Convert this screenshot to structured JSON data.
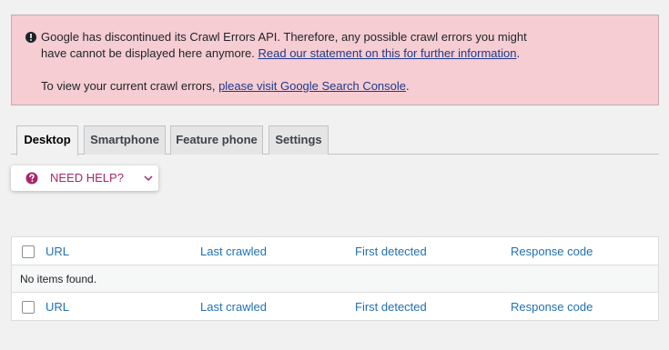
{
  "notice": {
    "line1": "Google has discontinued its Crawl Errors API. Therefore, any possible crawl errors you might",
    "line2_prefix": "have cannot be displayed here anymore. ",
    "line2_link": "Read our statement on this for further information",
    "line2_suffix": ".",
    "line3_prefix": "To view your current crawl errors, ",
    "line3_link": "please visit Google Search Console",
    "line3_suffix": ".",
    "icon": "alert-circle-icon",
    "colors": {
      "background": "#f6cdd3",
      "link": "#1e3a8a"
    }
  },
  "tabs": [
    {
      "label": "Desktop",
      "active": true
    },
    {
      "label": "Smartphone",
      "active": false
    },
    {
      "label": "Feature phone",
      "active": false
    },
    {
      "label": "Settings",
      "active": false
    }
  ],
  "help": {
    "label": "NEED HELP?",
    "icon": "question-circle-icon",
    "chevron": "chevron-down-icon",
    "color": "#a4286a"
  },
  "table": {
    "columns": [
      "URL",
      "Last crawled",
      "First detected",
      "Response code"
    ],
    "empty_message": "No items found.",
    "link_color": "#2271b1"
  }
}
